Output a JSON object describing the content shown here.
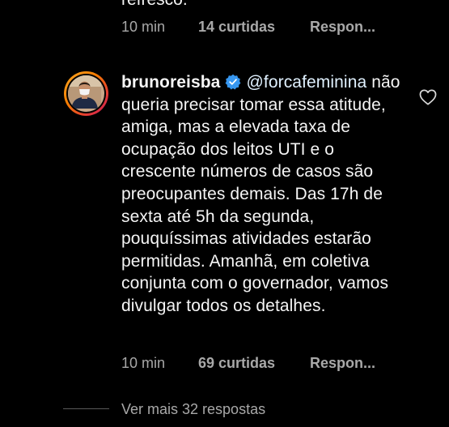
{
  "previous_comment": {
    "text_cut": "refresco.",
    "time": "10 min",
    "likes": "14 curtidas",
    "reply": "Respon..."
  },
  "comment": {
    "username": "brunoreisba",
    "mention": "@forcafeminina",
    "text": "não queria precisar tomar essa atitude, amiga, mas a elevada taxa de ocupação dos leitos UTI e o crescente números de casos são preocupantes demais. Das 17h de sexta até 5h da segunda, pouquíssimas atividades estarão permitidas. Amanhã, em coletiva conjunta com o governador, vamos divulgar todos os detalhes.",
    "time": "10 min",
    "likes": "69 curtidas",
    "reply": "Respon..."
  },
  "view_more": "Ver mais 32 respostas",
  "icons": {
    "verified": "verified-badge-icon",
    "like": "heart-outline-icon"
  },
  "colors": {
    "background": "#000000",
    "text": "#f5f5f5",
    "secondary": "#a8a8a8",
    "verified": "#3797f0"
  }
}
